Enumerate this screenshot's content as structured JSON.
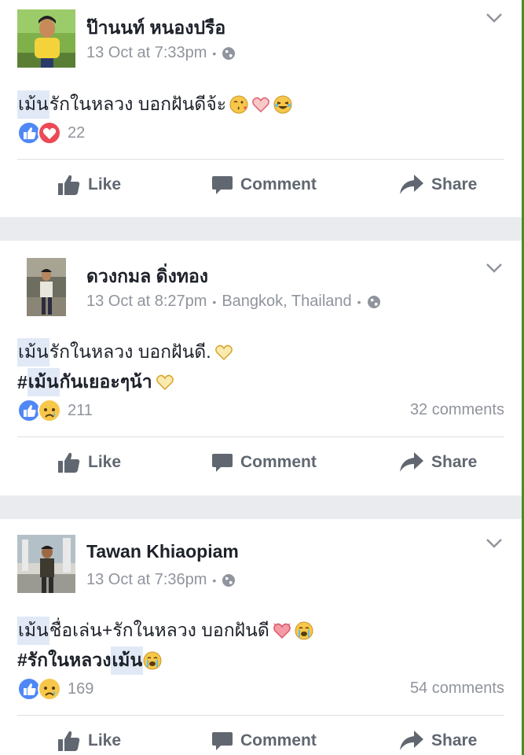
{
  "actions": {
    "like": "Like",
    "comment": "Comment",
    "share": "Share"
  },
  "posts": [
    {
      "author": "ป๊านนท์ หนองปรือ",
      "timestamp": "13 Oct at 7:33pm",
      "location": "",
      "line1_mention": "เม้น",
      "line1_rest": " รักในหลวง บอกฝันดีจ้ะ",
      "line2": "",
      "reaction_count": "22",
      "comments": "",
      "reactions": [
        "like-icon",
        "love-icon"
      ]
    },
    {
      "author": "ดวงกมล ดิ่งทอง",
      "timestamp": "13 Oct at 8:27pm",
      "location": "Bangkok, Thailand",
      "line1_mention": "เม้น",
      "line1_rest": " รักในหลวง บอกฝันดี.",
      "line2_prefix": "#",
      "line2_mention": "เม้น",
      "line2_rest": "กันเยอะๆน้า",
      "reaction_count": "211",
      "comments": "32 comments",
      "reactions": [
        "like-icon",
        "sad-icon"
      ]
    },
    {
      "author": "Tawan Khiaopiam",
      "timestamp": "13 Oct at 7:36pm",
      "location": "",
      "line1_mention": "เม้น",
      "line1_rest": " ชื่อเล่น+รักในหลวง บอกฝันดี",
      "line2_prefix": "#รักในหลวง",
      "line2_mention": "เม้น",
      "line2_rest": "",
      "reaction_count": "169",
      "comments": "54 comments",
      "reactions": [
        "like-icon",
        "sad-icon"
      ]
    }
  ],
  "colors": {
    "like_blue": "#4f88f5",
    "love_red": "#ed4956",
    "sad_yellow": "#f7c74a",
    "divider": "#e9ebee"
  }
}
